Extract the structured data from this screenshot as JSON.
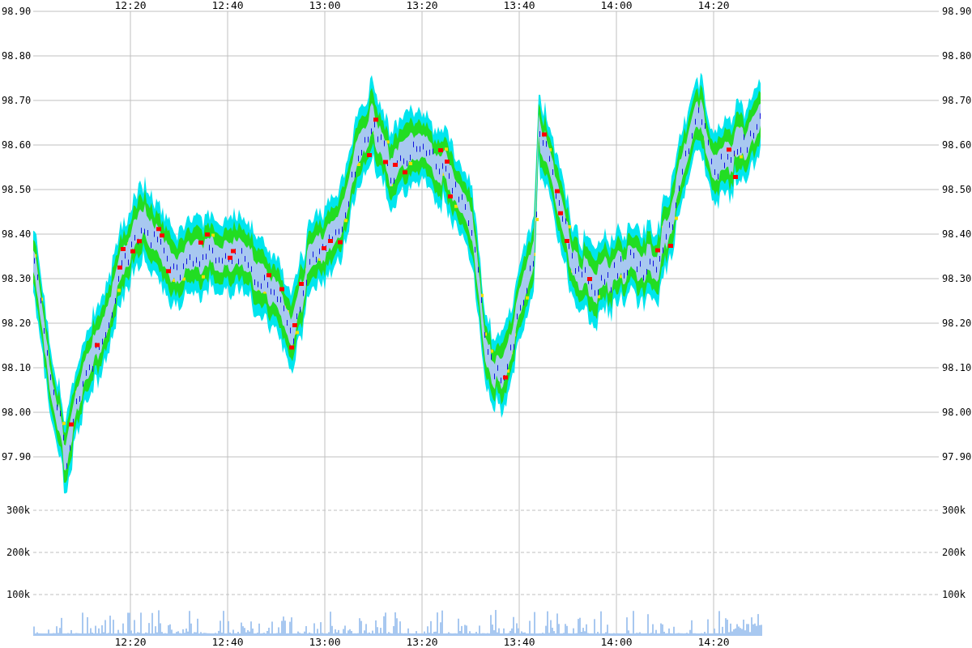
{
  "price_axis": {
    "left_labels": [
      "98.90",
      "98.80",
      "98.70",
      "98.60",
      "98.50",
      "98.40",
      "98.30",
      "98.20",
      "98.10",
      "98.00",
      "97.90"
    ],
    "right_labels": [
      "98.90",
      "98.80",
      "98.70",
      "98.60",
      "98.50",
      "98.40",
      "98.30",
      "98.20",
      "98.10",
      "98.00",
      "97.90"
    ]
  },
  "volume_axis": {
    "left_labels": [
      "300k",
      "200k",
      "100k"
    ],
    "right_labels": [
      "300k",
      "200k",
      "100k"
    ]
  },
  "time_axis": {
    "top_labels": [
      "12:20",
      "12:40",
      "13:00",
      "13:20",
      "13:40",
      "14:00",
      "14:20"
    ],
    "bottom_labels": [
      "12:20",
      "12:40",
      "13:00",
      "13:20",
      "13:40",
      "14:00",
      "14:20"
    ]
  }
}
